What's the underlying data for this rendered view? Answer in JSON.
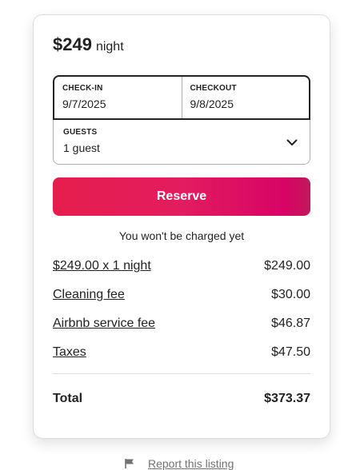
{
  "listing_card": {
    "price": "$249",
    "price_unit": "night",
    "check_in": {
      "label": "CHECK-IN",
      "value": "9/7/2025"
    },
    "checkout": {
      "label": "CHECKOUT",
      "value": "9/8/2025"
    },
    "guests": {
      "label": "GUESTS",
      "value": "1 guest",
      "icon": "chevron-down-icon"
    },
    "reserve_label": "Reserve",
    "note": "You won't be charged yet",
    "fees": [
      {
        "label": "$249.00 x 1 night",
        "amount": "$249.00"
      },
      {
        "label": "Cleaning fee",
        "amount": "$30.00"
      },
      {
        "label": "Airbnb service fee",
        "amount": "$46.87"
      },
      {
        "label": "Taxes",
        "amount": "$47.50"
      }
    ],
    "total_label": "Total",
    "total_amount": "$373.37"
  },
  "report": {
    "label": "Report this listing",
    "icon": "flag-icon"
  },
  "colors": {
    "accent": "#e31c5f",
    "text": "#222222",
    "border": "#dddddd",
    "muted": "#717171"
  }
}
